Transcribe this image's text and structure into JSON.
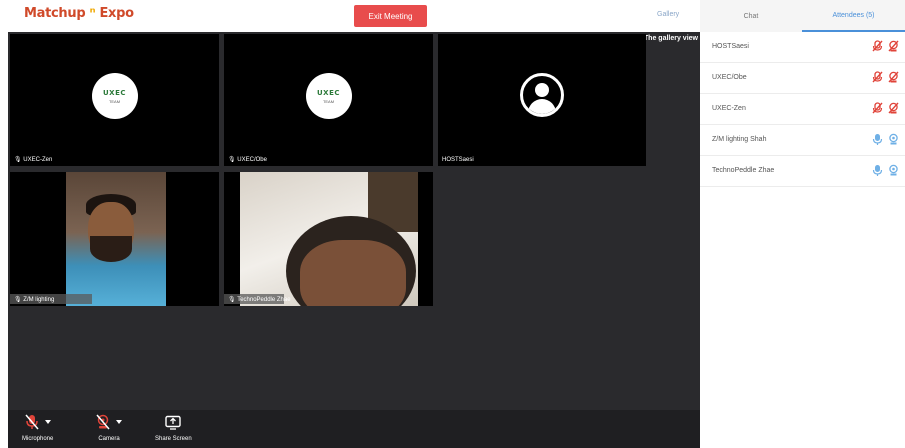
{
  "header": {
    "logo_text": "Matchup",
    "logo_text2": "Expo",
    "exit_label": "Exit Meeting",
    "top_link": "Gallery"
  },
  "stage": {
    "gallery_label": "The gallery view",
    "tiles": [
      {
        "name": "UXEC-Zen",
        "kind": "logo",
        "logo_text": "UXEC",
        "logo_sub": "TEAM",
        "muted": true
      },
      {
        "name": "UXEC/Obe",
        "kind": "logo",
        "logo_text": "UXEC",
        "logo_sub": "TEAM",
        "muted": true
      },
      {
        "name": "HOSTSaesi",
        "kind": "avatar",
        "muted": false
      },
      {
        "name": "Z/M lighting",
        "kind": "video",
        "muted": true
      },
      {
        "name": "TechnoPeddle Zhae",
        "kind": "video",
        "muted": true
      }
    ]
  },
  "toolbar": {
    "microphone_label": "Microphone",
    "camera_label": "Camera",
    "share_label": "Share Screen"
  },
  "sidebar": {
    "tab_chat": "Chat",
    "tab_attendees": "Attendees (5)",
    "participants": [
      {
        "name": "HOSTSaesi",
        "state": "muted"
      },
      {
        "name": "UXEC/Obe",
        "state": "muted"
      },
      {
        "name": "UXEC-Zen",
        "state": "muted"
      },
      {
        "name": "Z/M lighting Shah",
        "state": "active"
      },
      {
        "name": "TechnoPeddle Zhae",
        "state": "active"
      }
    ]
  },
  "colors": {
    "exit_button": "#e84c4c",
    "accent_blue": "#4a90d9",
    "muted_red": "#e0443a",
    "stage_bg": "#2a2a2d",
    "tile_bg": "#000000"
  },
  "icons": {
    "microphone": "microphone-icon",
    "camera": "camera-icon",
    "share": "share-screen-icon",
    "mic_muted": "mic-muted-icon",
    "cam_muted": "camera-muted-icon",
    "mic_on": "microphone-on-icon",
    "cam_on": "camera-on-icon"
  }
}
